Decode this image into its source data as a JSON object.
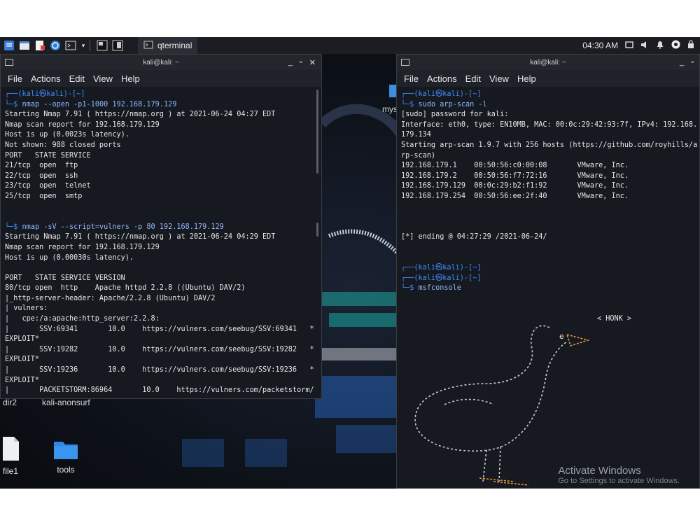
{
  "taskbar": {
    "task_label": "qterminal",
    "clock": "04:30 AM"
  },
  "desktop": {
    "icons": [
      {
        "label": "file1"
      },
      {
        "label": "tools"
      }
    ],
    "partial_labels": {
      "dir2": "dir2",
      "anonsurf": "kali-anonsurf",
      "mys": "mys"
    }
  },
  "left_terminal": {
    "title": "kali@kali: ~",
    "menu": [
      "File",
      "Actions",
      "Edit",
      "View",
      "Help"
    ],
    "lines": [
      {
        "cls": "c-blue",
        "text": "┌──(kali㉿kali)-[~]"
      },
      {
        "cls": "c-blue",
        "text": "└─$ ",
        "cmd": "nmap --open -p1-1000 192.168.179.129"
      },
      {
        "cls": "c-white",
        "text": "Starting Nmap 7.91 ( https://nmap.org ) at 2021-06-24 04:27 EDT"
      },
      {
        "cls": "c-white",
        "text": "Nmap scan report for 192.168.179.129"
      },
      {
        "cls": "c-white",
        "text": "Host is up (0.0023s latency)."
      },
      {
        "cls": "c-white",
        "text": "Not shown: 988 closed ports"
      },
      {
        "cls": "c-white",
        "text": "PORT   STATE SERVICE"
      },
      {
        "cls": "c-white",
        "text": "21/tcp  open  ftp"
      },
      {
        "cls": "c-white",
        "text": "22/tcp  open  ssh"
      },
      {
        "cls": "c-white",
        "text": "23/tcp  open  telnet"
      },
      {
        "cls": "c-white",
        "text": "25/tcp  open  smtp"
      },
      {
        "cls": "c-white",
        "text": ""
      },
      {
        "cls": "c-white",
        "text": ""
      },
      {
        "cls": "c-blue",
        "text": "└─$ ",
        "cmd": "nmap -sV --script=vulners -p 80 192.168.179.129"
      },
      {
        "cls": "c-white",
        "text": "Starting Nmap 7.91 ( https://nmap.org ) at 2021-06-24 04:29 EDT"
      },
      {
        "cls": "c-white",
        "text": "Nmap scan report for 192.168.179.129"
      },
      {
        "cls": "c-white",
        "text": "Host is up (0.00030s latency)."
      },
      {
        "cls": "c-white",
        "text": ""
      },
      {
        "cls": "c-white",
        "text": "PORT   STATE SERVICE VERSION"
      },
      {
        "cls": "c-white",
        "text": "80/tcp open  http    Apache httpd 2.2.8 ((Ubuntu) DAV/2)"
      },
      {
        "cls": "c-white",
        "text": "|_http-server-header: Apache/2.2.8 (Ubuntu) DAV/2"
      },
      {
        "cls": "c-white",
        "text": "| vulners:"
      },
      {
        "cls": "c-white",
        "text": "|   cpe:/a:apache:http_server:2.2.8:"
      },
      {
        "cls": "c-white",
        "text": "|       SSV:69341       10.0    https://vulners.com/seebug/SSV:69341   *"
      },
      {
        "cls": "c-white",
        "text": "EXPLOIT*"
      },
      {
        "cls": "c-white",
        "text": "|       SSV:19282       10.0    https://vulners.com/seebug/SSV:19282   *"
      },
      {
        "cls": "c-white",
        "text": "EXPLOIT*"
      },
      {
        "cls": "c-white",
        "text": "|       SSV:19236       10.0    https://vulners.com/seebug/SSV:19236   *"
      },
      {
        "cls": "c-white",
        "text": "EXPLOIT*"
      },
      {
        "cls": "c-white",
        "text": "|       PACKETSTORM:86964       10.0    https://vulners.com/packetstorm/"
      }
    ]
  },
  "right_terminal": {
    "title": "kali@kali: ~",
    "menu": [
      "File",
      "Actions",
      "Edit",
      "View",
      "Help"
    ],
    "lines": [
      {
        "cls": "c-blue",
        "text": "┌──(kali㉿kali)-[~]"
      },
      {
        "cls": "c-blue",
        "text": "└─$ ",
        "cmd": "sudo arp-scan -l"
      },
      {
        "cls": "c-white",
        "text": "[sudo] password for kali:"
      },
      {
        "cls": "c-white",
        "text": "Interface: eth0, type: EN10MB, MAC: 00:0c:29:42:93:7f, IPv4: 192.168."
      },
      {
        "cls": "c-white",
        "text": "179.134"
      },
      {
        "cls": "c-white",
        "text": "Starting arp-scan 1.9.7 with 256 hosts (https://github.com/royhills/a"
      },
      {
        "cls": "c-white",
        "text": "rp-scan)"
      },
      {
        "cls": "c-white",
        "text": "192.168.179.1    00:50:56:c0:00:08       VMware, Inc."
      },
      {
        "cls": "c-white",
        "text": "192.168.179.2    00:50:56:f7:72:16       VMware, Inc."
      },
      {
        "cls": "c-white",
        "text": "192.168.179.129  00:0c:29:b2:f1:92       VMware, Inc."
      },
      {
        "cls": "c-white",
        "text": "192.168.179.254  00:50:56:ee:2f:40       VMware, Inc."
      },
      {
        "cls": "c-white",
        "text": ""
      },
      {
        "cls": "c-white",
        "text": ""
      },
      {
        "cls": "c-white",
        "text": ""
      },
      {
        "cls": "c-white",
        "text": "[*] ending @ 04:27:29 /2021-06-24/"
      },
      {
        "cls": "c-white",
        "text": ""
      },
      {
        "cls": "c-white",
        "text": ""
      },
      {
        "cls": "c-blue",
        "text": "┌──(kali㉿kali)-[~]"
      },
      {
        "cls": "c-blue",
        "text": "┌──(kali㉿kali)-[~]"
      },
      {
        "cls": "c-blue",
        "text": "└─$ ",
        "cmd": "msfconsole"
      }
    ],
    "honk": "< HONK >"
  },
  "watermark": {
    "title": "Activate Windows",
    "subtitle": "Go to Settings to activate Windows."
  },
  "colors": {
    "prompt_blue": "#3f8cff",
    "terminal_bg": "#1f2229",
    "taskbar_bg": "#1b1d22"
  }
}
